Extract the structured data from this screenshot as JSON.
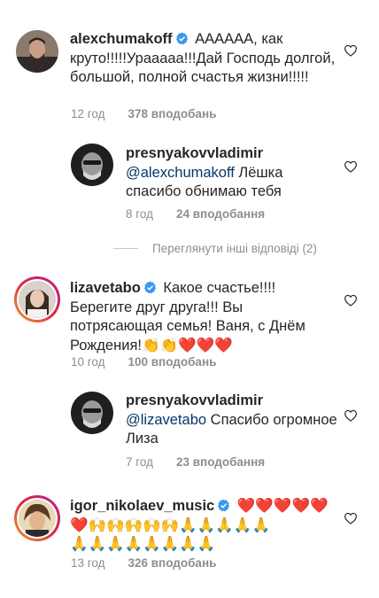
{
  "comments": [
    {
      "username": "alexchumakoff",
      "verified": true,
      "text": "АААААА, как круто!!!!!Урааааа!!!Дай Господь долгой, большой, полной счастья жизни!!!!!",
      "time": "12 год",
      "likes": "378 вподобань",
      "replies": [
        {
          "username": "presnyakovvladimir",
          "mention": "@alexchumakoff",
          "text": " Лёшка спасибо обнимаю тебя",
          "time": "8 год",
          "likes": "24 вподобання"
        }
      ],
      "view_more": "Переглянути інші відповіді (2)"
    },
    {
      "username": "lizavetabo",
      "verified": true,
      "text": "Какое счастье!!!! Берегите друг друга!!! Вы потрясающая семья! Ваня, с Днём Рождения!",
      "emoji": "👏👏❤️❤️❤️",
      "time": "10 год",
      "likes": "100 вподобань",
      "replies": [
        {
          "username": "presnyakovvladimir",
          "mention": "@lizavetabo",
          "text": " Спасибо огромное Лиза",
          "time": "7 год",
          "likes": "23 вподобання"
        }
      ]
    },
    {
      "username": "igor_nikolaev_music",
      "verified": true,
      "emoji_line1": "❤️❤️❤️❤️❤️",
      "emoji_line2": "❤️🙌🙌🙌🙌🙌🙏🙏🙏🙏🙏",
      "emoji_line3": "🙏🙏🙏🙏🙏🙏🙏🙏",
      "time": "13 год",
      "likes": "326 вподобань"
    }
  ],
  "icons": {
    "like": "heart-outline-icon",
    "verified": "verified-badge-icon"
  },
  "colors": {
    "verified": "#3897f0",
    "mention": "#00376b",
    "meta": "#8e8e8e",
    "heart": "#ed1c24"
  }
}
